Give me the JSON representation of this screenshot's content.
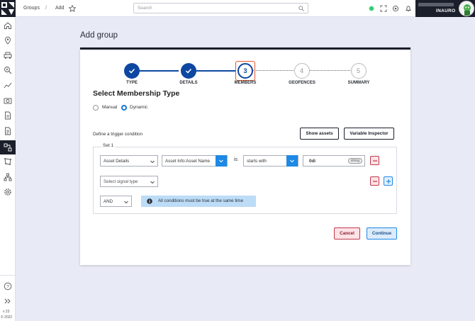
{
  "breadcrumb": {
    "root": "Groups",
    "separator": "/",
    "current": "Add"
  },
  "search": {
    "placeholder": "Search"
  },
  "user": {
    "org": "INAURO"
  },
  "page": {
    "title": "Add group"
  },
  "wizard": {
    "steps": [
      {
        "number": "1",
        "label": "TYPE",
        "state": "done"
      },
      {
        "number": "2",
        "label": "DETAILS",
        "state": "done"
      },
      {
        "number": "3",
        "label": "MEMBERS",
        "state": "active"
      },
      {
        "number": "4",
        "label": "GEOFENCES",
        "state": "todo"
      },
      {
        "number": "5",
        "label": "SUMMARY",
        "state": "todo"
      }
    ]
  },
  "membership": {
    "title": "Select Membership Type",
    "options": [
      {
        "label": "Manual",
        "selected": false
      },
      {
        "label": "Dynamic",
        "selected": true
      }
    ]
  },
  "trigger": {
    "label": "Define a trigger condition",
    "show_assets": "Show assets",
    "variable_inspector": "Variable Inspector",
    "set_title": "Set 1",
    "row1": {
      "field": "Asset Details",
      "attribute": "Asset Info:Asset Name",
      "is": "is",
      "operator": "starts with",
      "value": "0di",
      "value_type": "string"
    },
    "row2": {
      "placeholder": "Select signal type"
    },
    "logic": {
      "value": "AND",
      "info": "All conditions must be true at the same time"
    }
  },
  "actions": {
    "cancel": "Cancel",
    "continue": "Continue"
  },
  "footer": {
    "version": "v 23",
    "copyright": "© 2022"
  },
  "colors": {
    "primary": "#0d47a1",
    "accent": "#1e88e5",
    "dark": "#1b1f2b",
    "active_ring": "#e4572e",
    "danger": "#c0394b"
  }
}
